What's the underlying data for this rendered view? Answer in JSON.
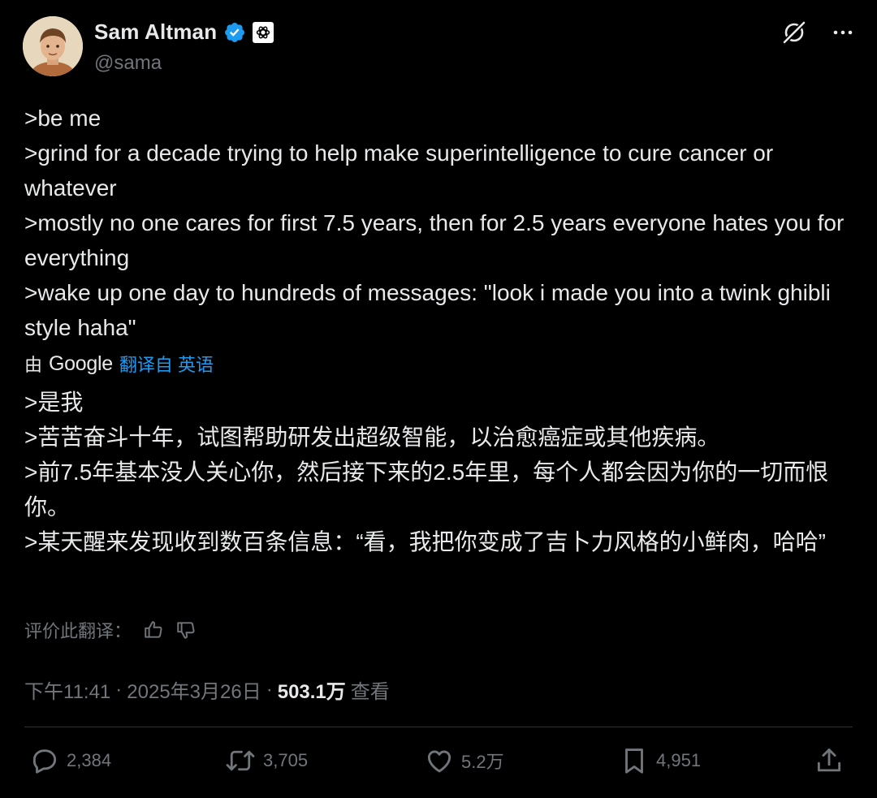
{
  "author": {
    "name": "Sam Altman",
    "handle": "@sama",
    "verified_icon": "verified-badge-icon",
    "affiliation_icon": "openai-logo-icon"
  },
  "header_actions": {
    "grok_icon": "grok-icon",
    "more_icon": "more-options-icon"
  },
  "tweet": {
    "lines": [
      ">be me",
      ">grind for a decade trying to help make superintelligence to cure cancer or whatever",
      ">mostly no one cares for first 7.5 years, then for 2.5 years everyone hates you for everything",
      ">wake up one day to hundreds of messages: \"look i made you into a twink ghibli style haha\""
    ]
  },
  "translation_bar": {
    "prefix": "由",
    "provider": "Google",
    "link_text": "翻译自 英语"
  },
  "translation": {
    "lines": [
      ">是我",
      ">苦苦奋斗十年，试图帮助研发出超级智能，以治愈癌症或其他疾病。",
      ">前7.5年基本没人关心你，然后接下来的2.5年里，每个人都会因为你的一切而恨你。",
      ">某天醒来发现收到数百条信息：“看，我把你变成了吉卜力风格的小鲜肉，哈哈”"
    ]
  },
  "rate_translation": {
    "label": "评价此翻译：",
    "thumbs_up_icon": "thumbs-up-icon",
    "thumbs_down_icon": "thumbs-down-icon"
  },
  "meta": {
    "time": "下午11:41",
    "separator": "·",
    "date": "2025年3月26日",
    "views_count": "503.1万",
    "views_label": "查看"
  },
  "engagement": {
    "replies": "2,384",
    "reposts": "3,705",
    "likes": "5.2万",
    "bookmarks": "4,951"
  },
  "colors": {
    "background": "#000000",
    "text": "#e7e9ea",
    "muted": "#71767b",
    "link": "#1d9bf0",
    "divider": "#2f3336"
  }
}
